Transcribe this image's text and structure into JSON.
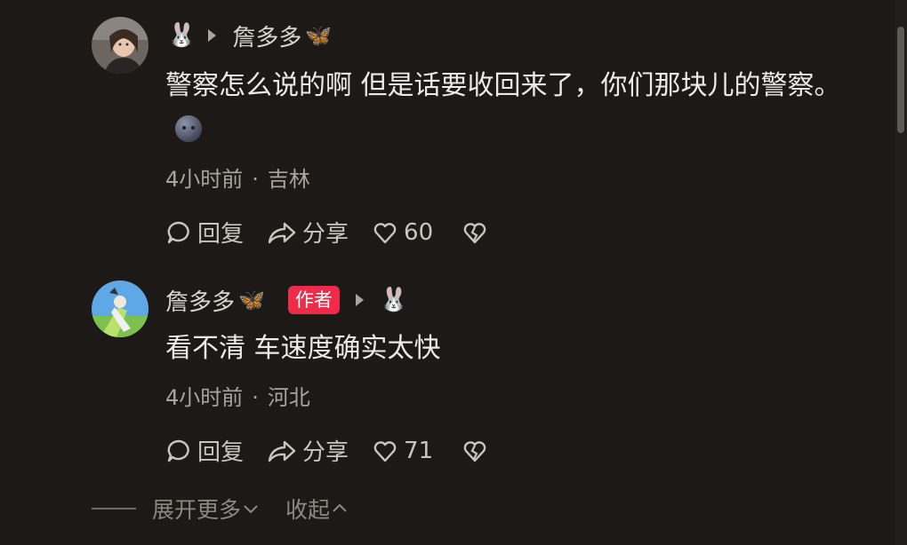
{
  "comments": [
    {
      "prefix_emoji": "🐰",
      "name": "詹多多",
      "name_suffix": "🦋",
      "body": "警察怎么说的啊 但是话要收回来了，你们那块儿的警察。",
      "body_emoji": "",
      "time": "4小时前",
      "location": "吉林",
      "reply_label": "回复",
      "share_label": "分享",
      "likes": "60"
    },
    {
      "name": "詹多多",
      "name_suffix": "🦋",
      "badge": "作者",
      "suffix_emoji": "🐰",
      "body": "看不清 车速度确实太快",
      "time": "4小时前",
      "location": "河北",
      "reply_label": "回复",
      "share_label": "分享",
      "likes": "71"
    }
  ],
  "footer": {
    "expand_label": "展开更多",
    "collapse_label": "收起"
  },
  "colors": {
    "background": "#1c1917",
    "badge": "#ee2b48",
    "butterfly": "#4aa3ff"
  }
}
